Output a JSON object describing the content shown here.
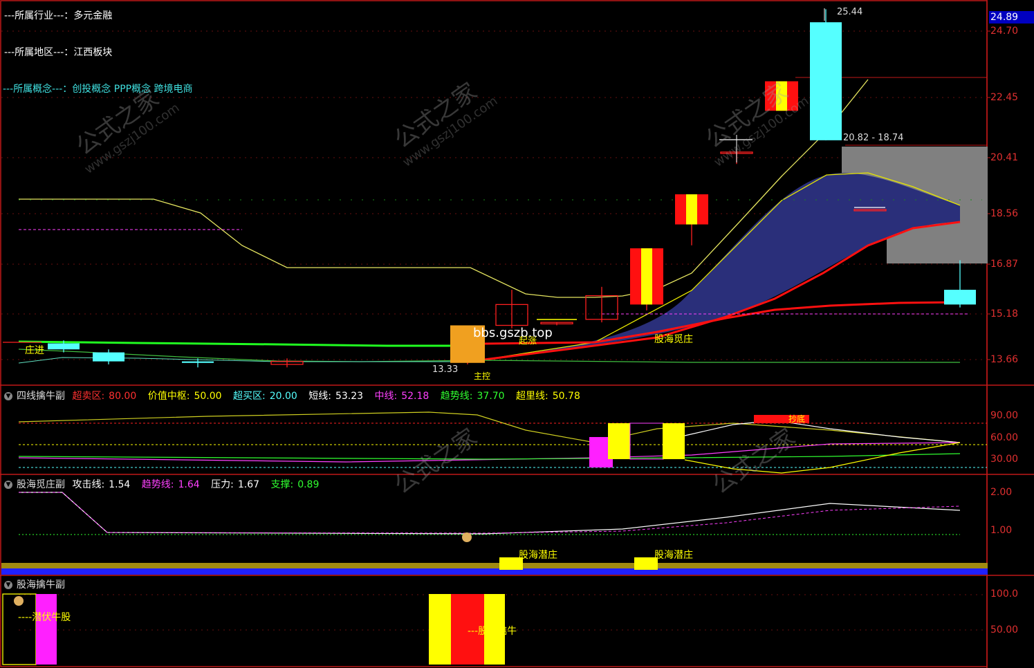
{
  "info": {
    "industry_label": "---所属行业---：",
    "industry_value": "多元金融",
    "region_label": "---所属地区---：",
    "region_value": "江西板块",
    "concept_label": "---所属概念---：",
    "concept_value": "创投概念 PPP概念 跨境电商"
  },
  "main_panel": {
    "current_price": "24.89",
    "y_ticks": [
      "24.70",
      "22.45",
      "20.41",
      "18.56",
      "16.87",
      "15.18",
      "13.66"
    ],
    "annotations": {
      "high": "25.44",
      "low": "13.33",
      "range": "20.82 - 18.74",
      "watermark_site": "bbs.gszb.top",
      "zhuang_jin": "庄进",
      "gu_hai_mi_zhuang": "股海觅庄",
      "qi_dong": "起涨",
      "zhu_kong": "主控"
    },
    "colors": {
      "up": "#ff0000",
      "up_fill": "#ffff00",
      "down": "#55ffff",
      "band": "#2a2f7a",
      "gray_box": "#808080"
    }
  },
  "panel2": {
    "title": "四线擒牛副",
    "legend": [
      {
        "label": "超卖区:",
        "value": "80.00",
        "color": "#ff3030"
      },
      {
        "label": "价值中枢:",
        "value": "50.00",
        "color": "#ffff00"
      },
      {
        "label": "超买区:",
        "value": "20.00",
        "color": "#55ffff"
      },
      {
        "label": "短线:",
        "value": "53.23",
        "color": "#ffffff"
      },
      {
        "label": "中线:",
        "value": "52.18",
        "color": "#ff40ff"
      },
      {
        "label": "趋势线:",
        "value": "37.70",
        "color": "#30ff30"
      },
      {
        "label": "超里线:",
        "value": "50.78",
        "color": "#ffff00"
      }
    ],
    "y_ticks": [
      "90.00",
      "60.00",
      "30.00"
    ],
    "badge": "抄底"
  },
  "panel3": {
    "title": "股海觅庄副",
    "legend": [
      {
        "label": "攻击线:",
        "value": "1.54",
        "color": "#ffffff"
      },
      {
        "label": "趋势线:",
        "value": "1.64",
        "color": "#ff40ff"
      },
      {
        "label": "压力:",
        "value": "1.67",
        "color": "#ffffff"
      },
      {
        "label": "支撑:",
        "value": "0.89",
        "color": "#30ff30"
      }
    ],
    "y_ticks": [
      "2.00",
      "1.00"
    ],
    "signal_label": "股海潜庄"
  },
  "panel4": {
    "title": "股海擒牛副",
    "y_ticks": [
      "100.0",
      "50.00"
    ],
    "label_left": "----潜伏牛股",
    "label_mid": "---股海擒牛"
  },
  "watermark": {
    "brand": "公式之家",
    "site": "www.gszj100.com"
  },
  "chart_data": {
    "type": "bar",
    "title": "",
    "candles": [
      {
        "open": 14.2,
        "close": 14.0,
        "high": 14.3,
        "low": 13.9
      },
      {
        "open": 13.9,
        "close": 13.6,
        "high": 14.0,
        "low": 13.5
      },
      {
        "open": 13.6,
        "close": 13.55,
        "high": 13.7,
        "low": 13.4
      },
      {
        "open": 13.5,
        "close": 13.6,
        "high": 13.7,
        "low": 13.4
      },
      {
        "open": 13.55,
        "close": 14.8,
        "high": 14.8,
        "low": 13.5
      },
      {
        "open": 14.8,
        "close": 15.5,
        "high": 16.0,
        "low": 14.7
      },
      {
        "open": 14.85,
        "close": 14.9,
        "high": 14.9,
        "low": 14.8
      },
      {
        "open": 15.0,
        "close": 15.8,
        "high": 16.1,
        "low": 14.9
      },
      {
        "open": 15.5,
        "close": 17.4,
        "high": 17.4,
        "low": 15.3
      },
      {
        "open": 18.2,
        "close": 19.2,
        "high": 19.2,
        "low": 17.5
      },
      {
        "open": 20.6,
        "close": 20.6,
        "high": 20.6,
        "low": 20.2
      },
      {
        "open": 22.0,
        "close": 23.0,
        "high": 23.0,
        "low": 22.0
      },
      {
        "open": 25.0,
        "close": 21.0,
        "high": 25.44,
        "low": 21.0
      },
      {
        "open": 18.7,
        "close": 18.7,
        "high": 18.7,
        "low": 18.7
      },
      {
        "open": 16.0,
        "close": 15.5,
        "high": 17.0,
        "low": 15.4
      }
    ],
    "y_ticks": [
      24.7,
      22.45,
      20.41,
      18.56,
      16.87,
      15.18,
      13.66
    ]
  }
}
